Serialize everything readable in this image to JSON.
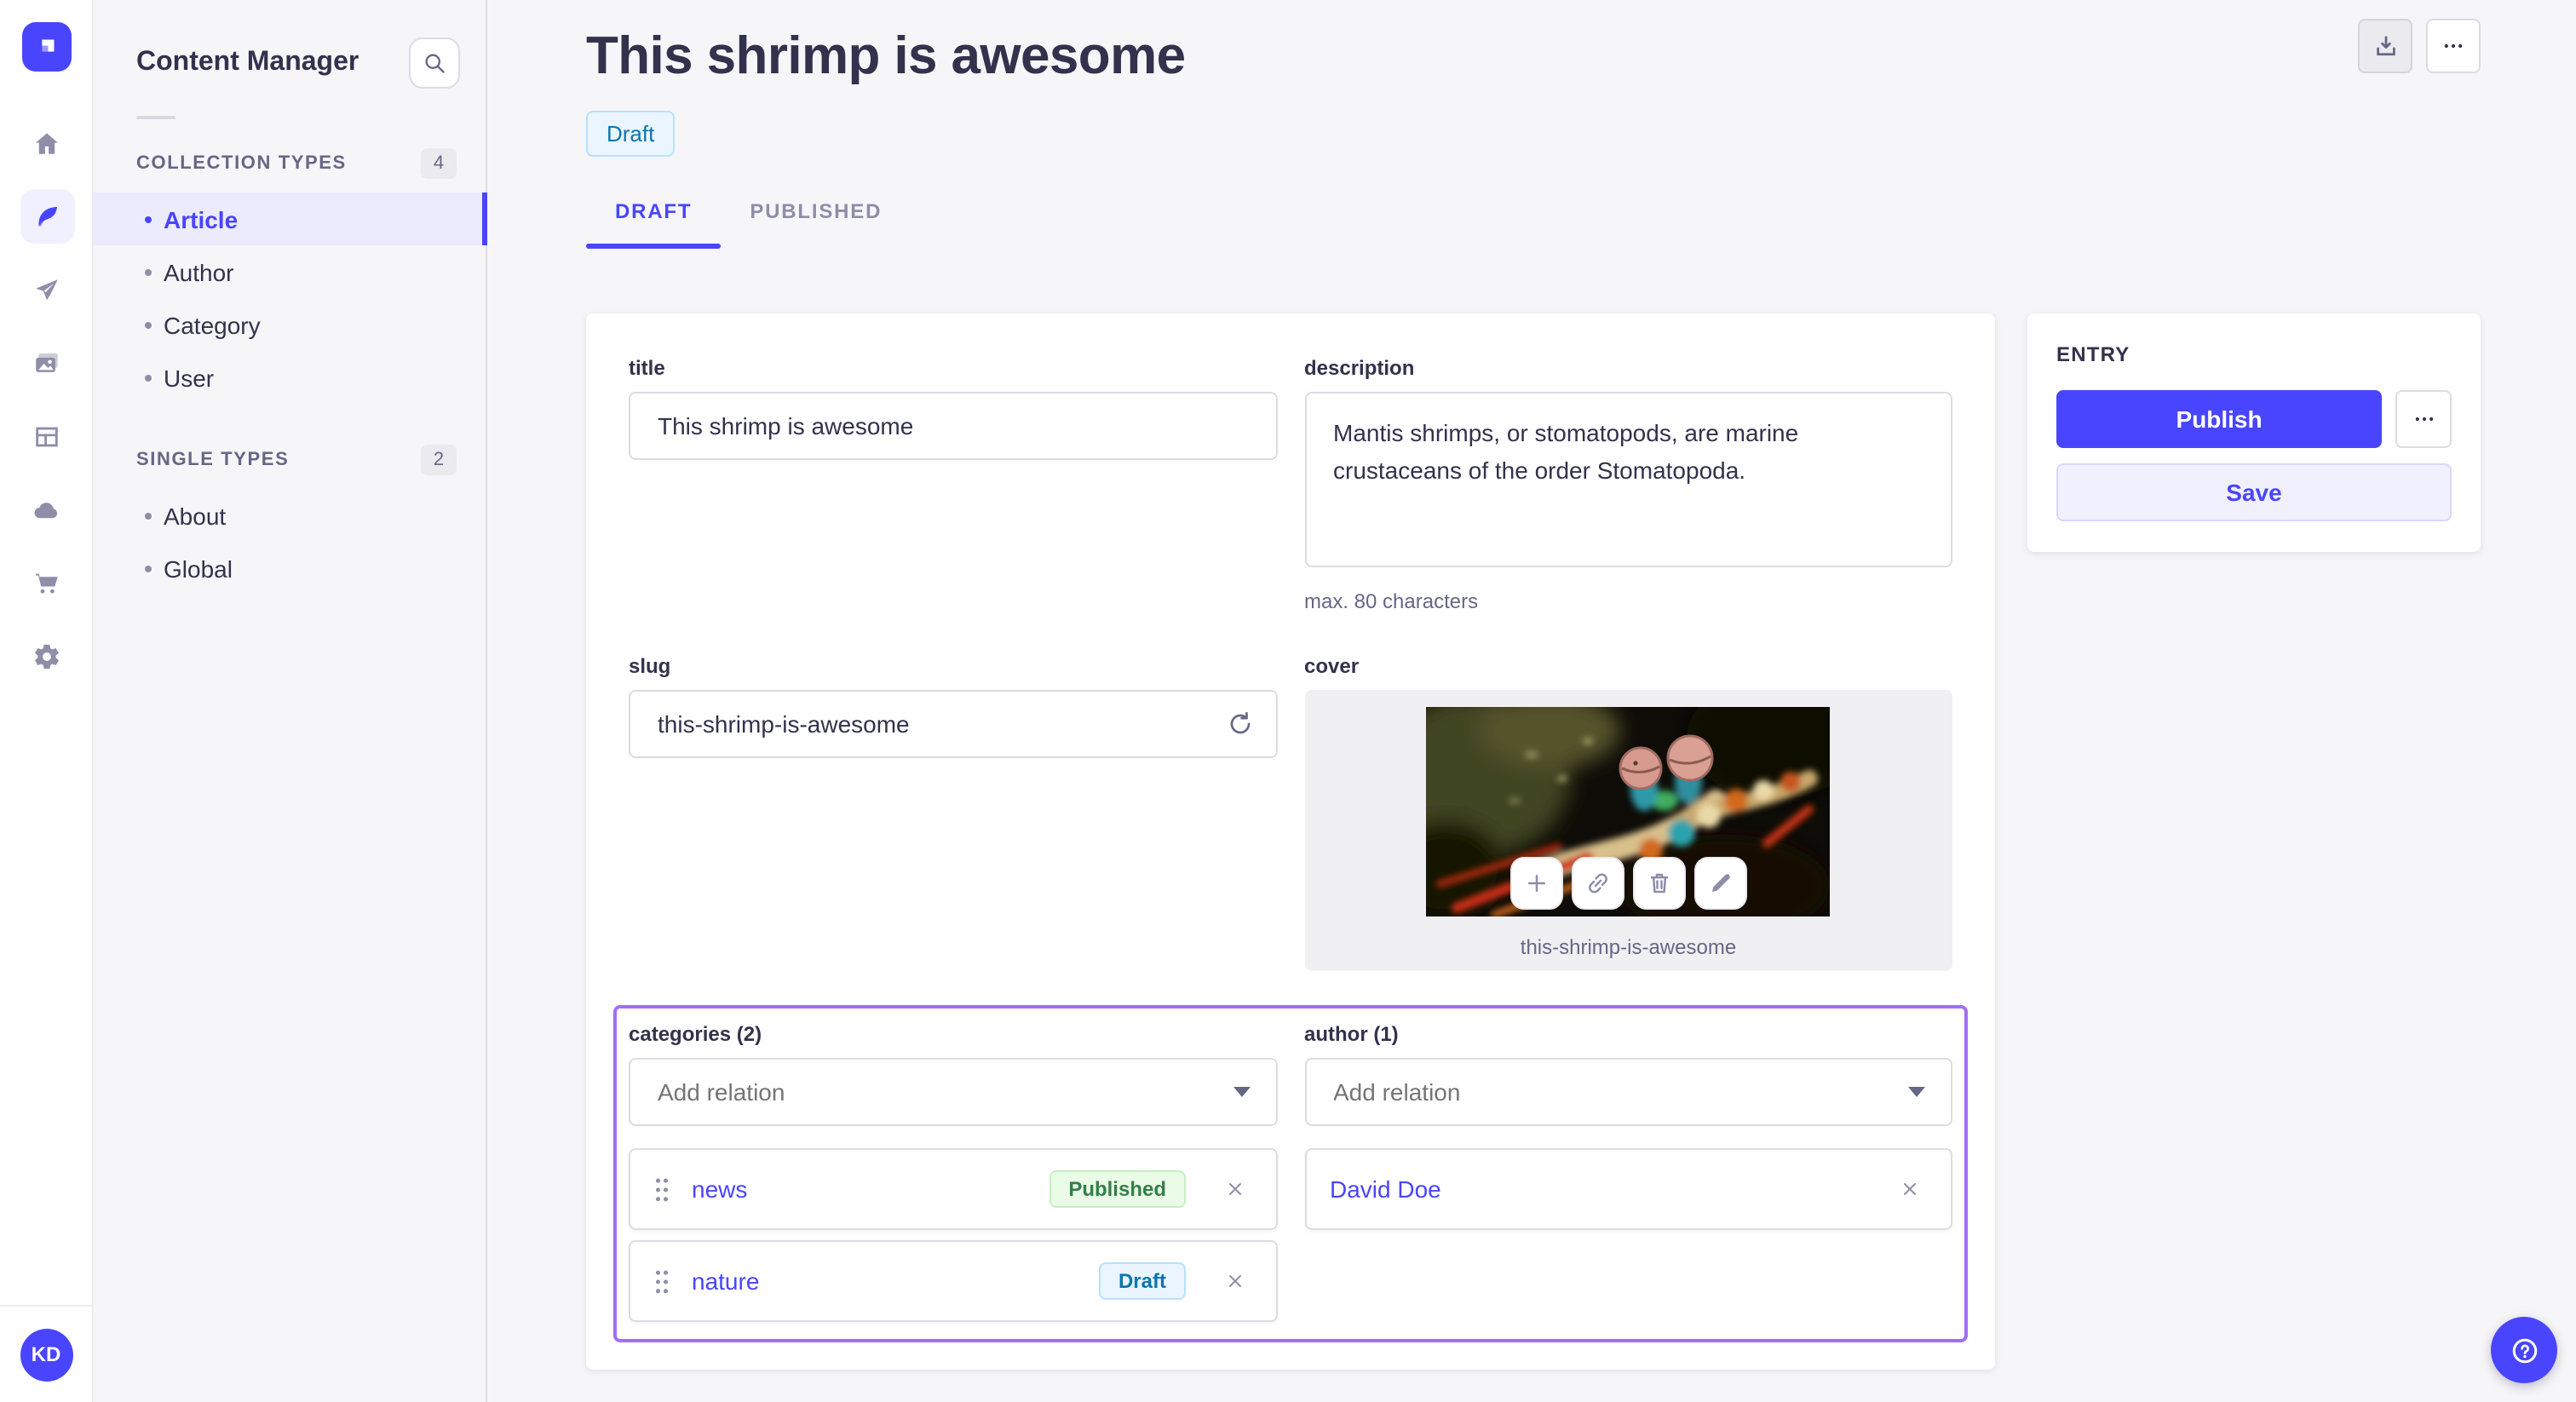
{
  "colors": {
    "primary": "#4945ff",
    "selection_border": "#a26ef4",
    "published_text": "#328048",
    "draft_text": "#0c75af",
    "background": "#f6f6f9"
  },
  "rail": {
    "icons": [
      "strapi-logo",
      "home",
      "feather",
      "paper-plane",
      "media",
      "layout",
      "cloud",
      "cart",
      "gear"
    ],
    "user_initials": "KD"
  },
  "sidebar": {
    "title": "Content Manager",
    "search_icon": "search-icon",
    "sections": [
      {
        "label": "COLLECTION TYPES",
        "count": "4",
        "items": [
          {
            "label": "Article",
            "active": true
          },
          {
            "label": "Author",
            "active": false
          },
          {
            "label": "Category",
            "active": false
          },
          {
            "label": "User",
            "active": false
          }
        ]
      },
      {
        "label": "SINGLE TYPES",
        "count": "2",
        "items": [
          {
            "label": "About",
            "active": false
          },
          {
            "label": "Global",
            "active": false
          }
        ]
      }
    ]
  },
  "header": {
    "title": "This shrimp is awesome",
    "status": "Draft",
    "actions": [
      "download-icon",
      "more-options-icon"
    ]
  },
  "tabs": {
    "draft": "DRAFT",
    "published": "PUBLISHED"
  },
  "form": {
    "title": {
      "label": "title",
      "value": "This shrimp is awesome"
    },
    "description": {
      "label": "description",
      "value": "Mantis shrimps, or stomatopods, are marine crustaceans of the order Stomatopoda.",
      "hint": "max. 80 characters"
    },
    "slug": {
      "label": "slug",
      "value": "this-shrimp-is-awesome",
      "action_icon": "refresh-icon"
    },
    "cover": {
      "label": "cover",
      "caption": "this-shrimp-is-awesome",
      "action_icons": [
        "plus-icon",
        "link-icon",
        "trash-icon",
        "pencil-icon"
      ]
    },
    "categories": {
      "label": "categories (2)",
      "placeholder": "Add relation",
      "items": [
        {
          "name": "news",
          "status": "Published"
        },
        {
          "name": "nature",
          "status": "Draft"
        }
      ]
    },
    "author": {
      "label": "author (1)",
      "placeholder": "Add relation",
      "items": [
        {
          "name": "David Doe"
        }
      ]
    }
  },
  "entry": {
    "title": "ENTRY",
    "publish": "Publish",
    "save": "Save",
    "more_icon": "more-options-icon"
  },
  "help": {
    "icon": "question-mark-icon"
  }
}
